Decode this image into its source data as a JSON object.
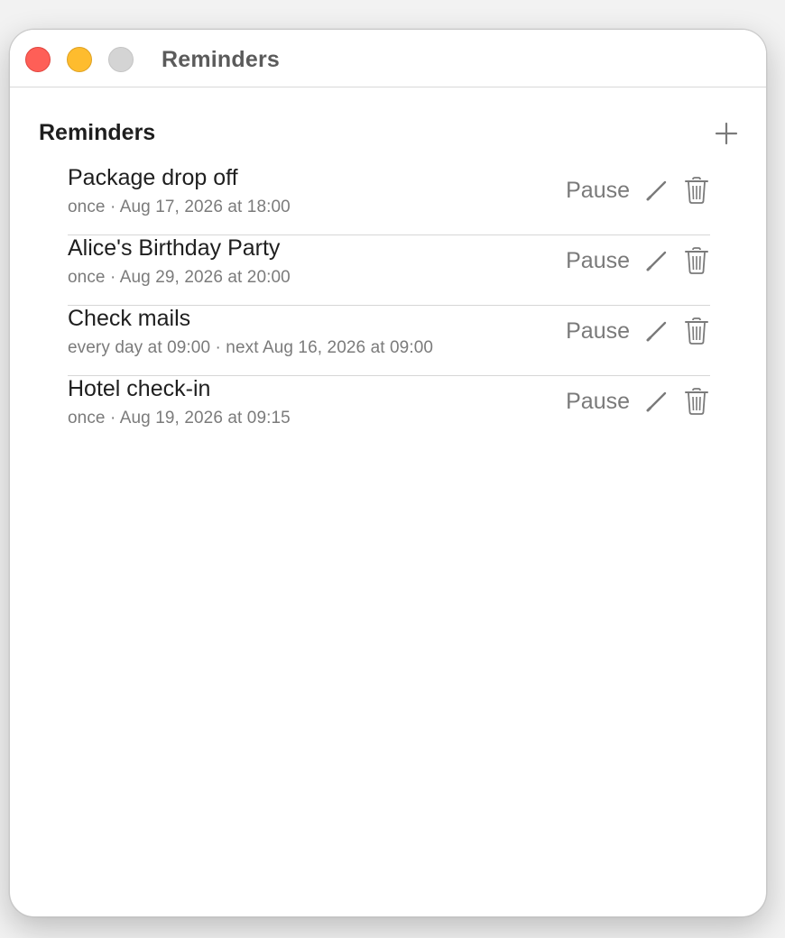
{
  "window": {
    "title": "Reminders"
  },
  "section": {
    "title": "Reminders",
    "add_icon": "plus-icon"
  },
  "reminders": [
    {
      "title": "Package drop off",
      "schedule": "once · Aug 17, 2026 at 18:00",
      "pause_label": "Pause"
    },
    {
      "title": "Alice's Birthday Party",
      "schedule": "once · Aug 29, 2026 at 20:00",
      "pause_label": "Pause"
    },
    {
      "title": "Check mails",
      "schedule": "every day at 09:00 · next Aug 16, 2026 at 09:00",
      "pause_label": "Pause"
    },
    {
      "title": "Hotel check-in",
      "schedule": "once · Aug 19, 2026 at 09:15",
      "pause_label": "Pause"
    }
  ],
  "icons": {
    "edit": "pencil-icon",
    "delete": "trash-icon"
  },
  "colors": {
    "close": "#fe5f57",
    "minimize": "#febc2e",
    "zoom_inactive": "#d4d4d4"
  }
}
